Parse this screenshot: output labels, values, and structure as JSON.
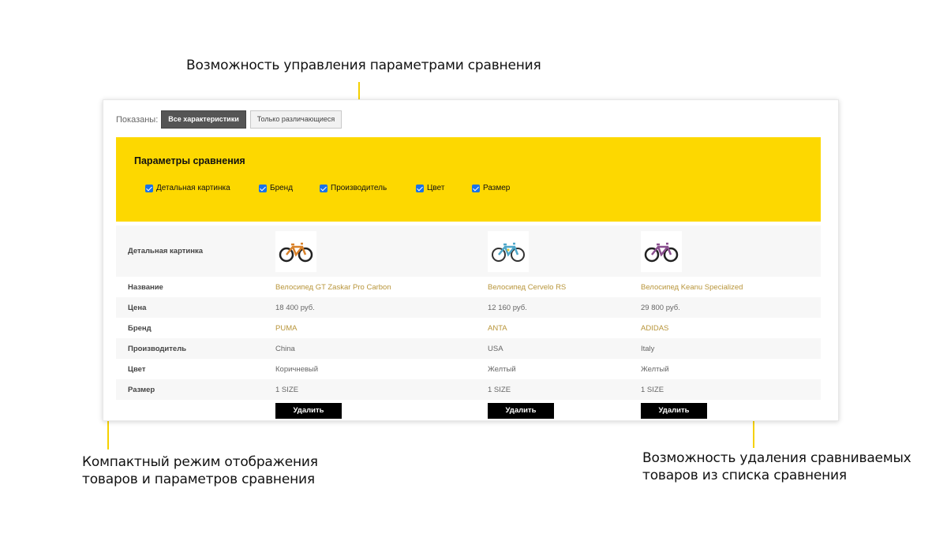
{
  "annotations": {
    "top": "Возможность управления параметрами сравнения",
    "left_line1": "Компактный режим отображения",
    "left_line2": "товаров и параметров сравнения",
    "right_line1": "Возможность удаления сравниваемых",
    "right_line2": "товаров из списка сравнения",
    "accent_color": "#f5d100"
  },
  "toolbar": {
    "shown_label": "Показаны:",
    "all_label": "Все характеристики",
    "diff_label": "Только различающиеся"
  },
  "params": {
    "title": "Параметры сравнения",
    "options": [
      {
        "label": "Детальная картинка",
        "checked": true
      },
      {
        "label": "Бренд",
        "checked": true
      },
      {
        "label": "Производитель",
        "checked": true
      },
      {
        "label": "Цвет",
        "checked": true
      },
      {
        "label": "Размер",
        "checked": true
      }
    ]
  },
  "table": {
    "rows": {
      "image": "Детальная картинка",
      "name": "Название",
      "price": "Цена",
      "brand": "Бренд",
      "manufacturer": "Производитель",
      "color": "Цвет",
      "size": "Размер"
    },
    "products": [
      {
        "name": "Велосипед GT Zaskar Pro Carbon",
        "price": "18 400 руб.",
        "brand": "PUMA",
        "manufacturer": "China",
        "color": "Коричневый",
        "size": "1 SIZE",
        "bike_color": "#d9822b",
        "image_icon": "bicycle-icon"
      },
      {
        "name": "Велосипед Cervelo RS",
        "price": "12 160 руб.",
        "brand": "ANTA",
        "manufacturer": "USA",
        "color": "Желтый",
        "size": "1 SIZE",
        "bike_color": "#4fa7c9",
        "image_icon": "bicycle-icon"
      },
      {
        "name": "Велосипед Keanu Specialized",
        "price": "29 800 руб.",
        "brand": "ADIDAS",
        "manufacturer": "Italy",
        "color": "Желтый",
        "size": "1 SIZE",
        "bike_color": "#8a4f8f",
        "image_icon": "bicycle-icon"
      }
    ],
    "delete_label": "Удалить"
  }
}
